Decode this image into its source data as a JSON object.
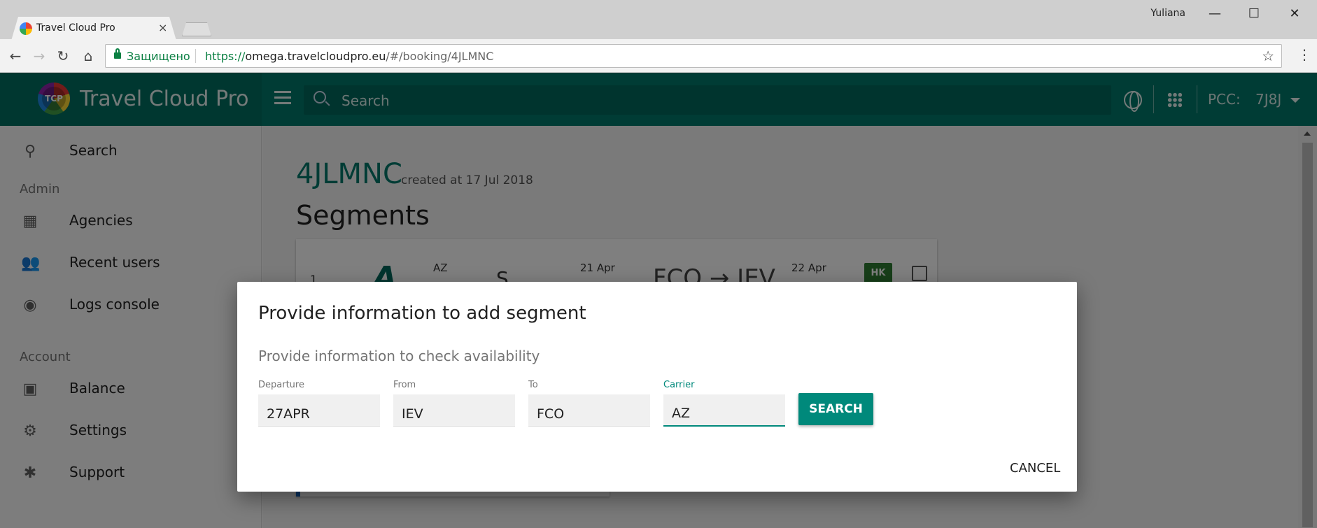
{
  "browser": {
    "tab_title": "Travel Cloud Pro",
    "tab_close": "×",
    "profile_name": "Yuliana",
    "minimize": "—",
    "maximize": "☐",
    "close": "✕",
    "secure_label": "Защищено",
    "url_proto": "https://",
    "url_host": "omega.travelcloudpro.eu",
    "url_path": "/#/booking/4JLMNC"
  },
  "appbar": {
    "brand": "Travel Cloud Pro",
    "logo_text": "TCP",
    "search_placeholder": "Search",
    "pcc_label": "PCC:",
    "pcc_value": "7J8J"
  },
  "sidebar": {
    "search": "Search",
    "admin_header": "Admin",
    "agencies": "Agencies",
    "recent_users": "Recent users",
    "logs_console": "Logs console",
    "account_header": "Account",
    "balance": "Balance",
    "settings": "Settings",
    "support": "Support"
  },
  "booking": {
    "pnr": "4JLMNC",
    "created": "created at 17 Jul 2018",
    "segments_title": "Segments",
    "segment": {
      "number": "1",
      "carrier": "AZ",
      "class": "S",
      "dep_date": "21 Apr",
      "route": "FCO → IEV",
      "arr_date": "22 Apr",
      "status": "HK"
    }
  },
  "dialog": {
    "title": "Provide information to add segment",
    "subtitle": "Provide information to check availability",
    "fields": [
      {
        "label": "Departure",
        "value": "27APR"
      },
      {
        "label": "From",
        "value": "IEV"
      },
      {
        "label": "To",
        "value": "FCO"
      },
      {
        "label": "Carrier",
        "value": "AZ"
      }
    ],
    "search_label": "SEARCH",
    "cancel_label": "CANCEL"
  },
  "colors": {
    "primary": "#00796b",
    "accent": "#00897b",
    "status_hk": "#2e7d32"
  }
}
